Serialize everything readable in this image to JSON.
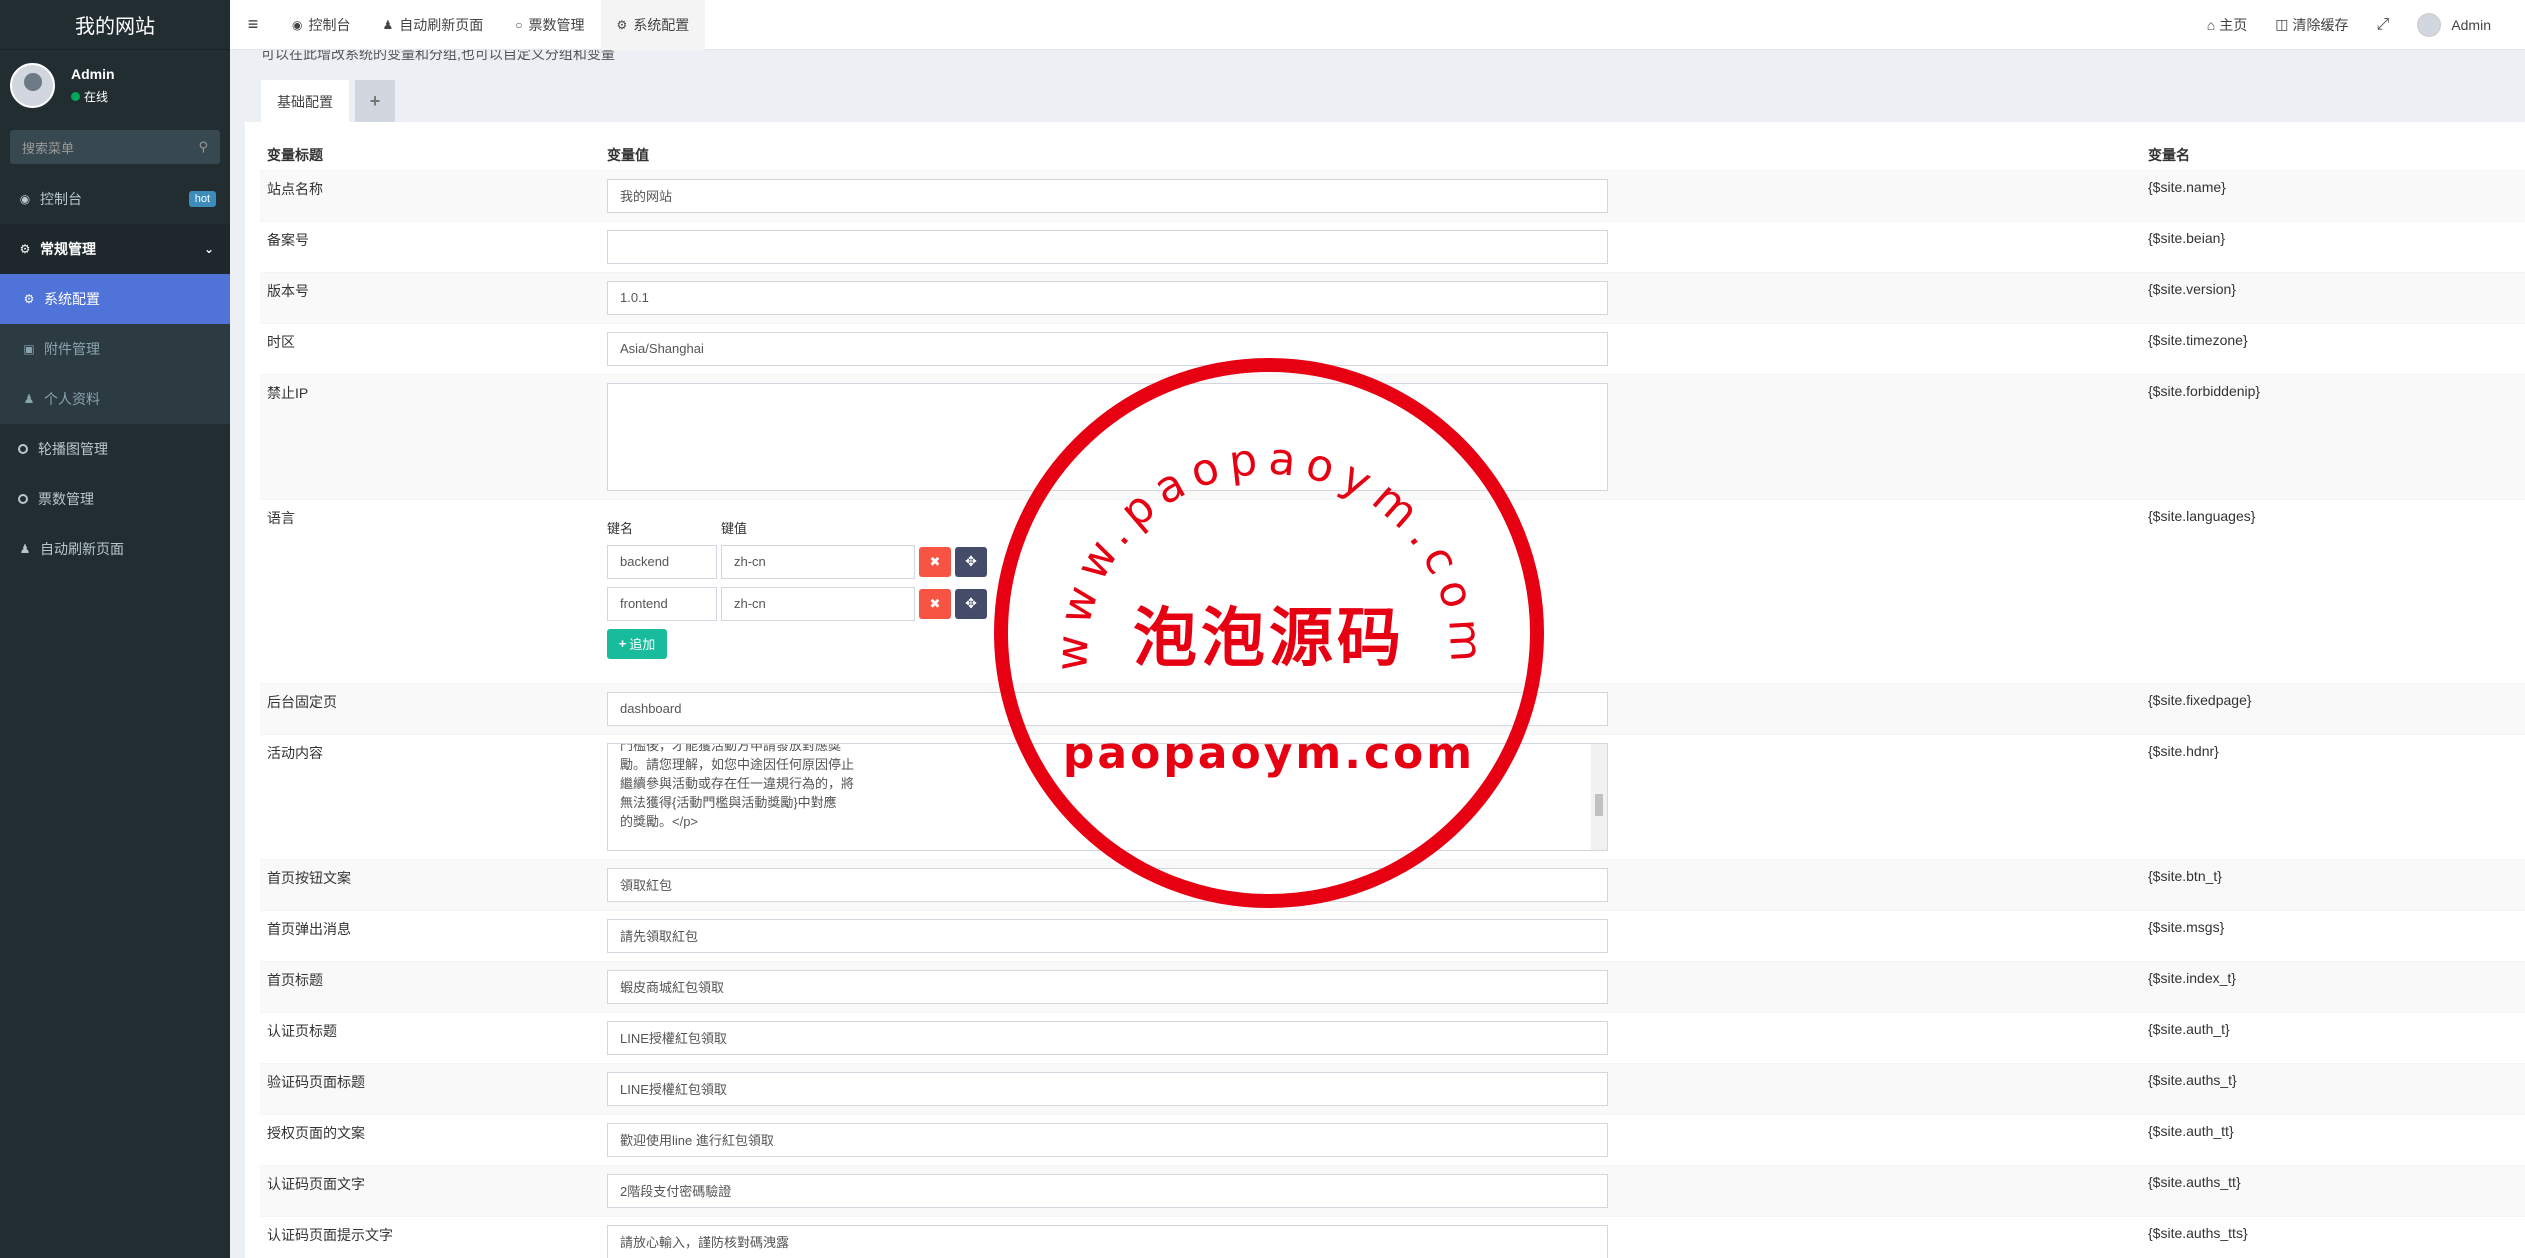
{
  "sidebar": {
    "site_title": "我的网站",
    "user_name": "Admin",
    "user_status": "在线",
    "search_placeholder": "搜索菜单",
    "items": {
      "dashboard": "控制台",
      "dashboard_badge": "hot",
      "general": "常规管理",
      "sys_config": "系统配置",
      "attachments": "附件管理",
      "profile": "个人资料",
      "carousel": "轮播图管理",
      "tickets": "票数管理",
      "auto_refresh": "自动刷新页面"
    }
  },
  "topbar": {
    "tabs": [
      "控制台",
      "自动刷新页面",
      "票数管理",
      "系统配置"
    ],
    "home": "主页",
    "clear_cache": "清除缓存",
    "admin": "Admin"
  },
  "content": {
    "info": "可以在此增改系统的变量和分组,也可以自定义分组和变量",
    "tab_base": "基础配置",
    "tab_add": "+",
    "headers": {
      "title": "变量标题",
      "value": "变量值",
      "name": "变量名"
    },
    "rows": {
      "site_name": {
        "title": "站点名称",
        "value": "我的网站",
        "name": "{$site.name}"
      },
      "beian": {
        "title": "备案号",
        "value": "",
        "name": "{$site.beian}"
      },
      "version": {
        "title": "版本号",
        "value": "1.0.1",
        "name": "{$site.version}"
      },
      "timezone": {
        "title": "时区",
        "value": "Asia/Shanghai",
        "name": "{$site.timezone}"
      },
      "forbiddenip": {
        "title": "禁止IP",
        "value": "",
        "name": "{$site.forbiddenip}"
      },
      "languages": {
        "title": "语言",
        "name": "{$site.languages}",
        "key_label": "键名",
        "val_label": "键值",
        "entries": [
          {
            "key": "backend",
            "value": "zh-cn"
          },
          {
            "key": "frontend",
            "value": "zh-cn"
          }
        ],
        "add_label": "追加"
      },
      "fixedpage": {
        "title": "后台固定页",
        "value": "dashboard",
        "name": "{$site.fixedpage}"
      },
      "hdnr": {
        "title": "活动内容",
        "lines": [
          "門檻後，才能獲活動方申請發放對應獎",
          "勵。請您理解，如您中途因任何原因停止",
          "繼續參與活動或存在任一違規行為的，將",
          "無法獲得{活動門檻與活動獎勵}中對應",
          "的獎勵。</p>"
        ],
        "name": "{$site.hdnr}"
      },
      "btn_t": {
        "title": "首页按钮文案",
        "value": "領取紅包",
        "name": "{$site.btn_t}"
      },
      "msgs": {
        "title": "首页弹出消息",
        "value": "請先領取紅包",
        "name": "{$site.msgs}"
      },
      "index_t": {
        "title": "首页标题",
        "value": "蝦皮商城紅包領取",
        "name": "{$site.index_t}"
      },
      "auth_t": {
        "title": "认证页标题",
        "value": "LINE授權紅包領取",
        "name": "{$site.auth_t}"
      },
      "auths_t": {
        "title": "验证码页面标题",
        "value": "LINE授權紅包領取",
        "name": "{$site.auths_t}"
      },
      "auth_tt": {
        "title": "授权页面的文案",
        "value": "歡迎使用line 進行紅包領取",
        "name": "{$site.auth_tt}"
      },
      "auths_tt": {
        "title": "认证码页面文字",
        "value": "2階段支付密碼驗證",
        "name": "{$site.auths_tt}"
      },
      "auths_tts": {
        "title": "认证码页面提示文字",
        "value": "請放心輸入，謹防核對碼洩露",
        "name": "{$site.auths_tts}"
      }
    }
  },
  "watermark": {
    "arc_text": "www.paopaoym.com",
    "center_text": "泡泡源码",
    "bottom_text": "paopaoym.com",
    "color": "#e60012"
  }
}
